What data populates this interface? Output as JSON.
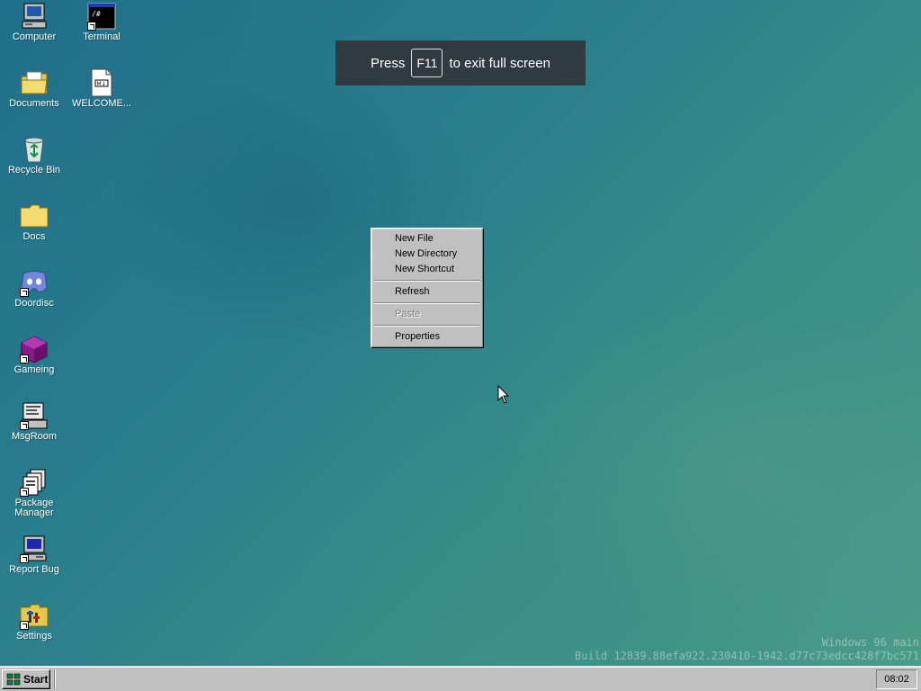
{
  "desktop_icons": [
    {
      "label": "Computer",
      "icon": "computer-icon",
      "shortcut": false
    },
    {
      "label": "Terminal",
      "icon": "terminal-icon",
      "shortcut": true
    },
    {
      "label": "Documents",
      "icon": "documents-folder-icon",
      "shortcut": false
    },
    {
      "label": "WELCOME...",
      "icon": "markdown-file-icon",
      "shortcut": false
    },
    {
      "label": "Recycle Bin",
      "icon": "recycle-bin-icon",
      "shortcut": false
    },
    {
      "label": "Docs",
      "icon": "folder-icon",
      "shortcut": false
    },
    {
      "label": "Doordisc",
      "icon": "doordisc-icon",
      "shortcut": true
    },
    {
      "label": "Gameing",
      "icon": "gameing-cube-icon",
      "shortcut": true
    },
    {
      "label": "MsgRoom",
      "icon": "msgroom-icon",
      "shortcut": true
    },
    {
      "label": "Package Manager",
      "icon": "package-manager-icon",
      "shortcut": true
    },
    {
      "label": "Report Bug",
      "icon": "report-bug-computer-icon",
      "shortcut": true
    },
    {
      "label": "Settings",
      "icon": "settings-folder-icon",
      "shortcut": true
    }
  ],
  "fullscreen_notice": {
    "prefix": "Press",
    "key": "F11",
    "suffix": "to exit full screen"
  },
  "context_menu": {
    "items": [
      {
        "label": "New File",
        "disabled": false
      },
      {
        "label": "New Directory",
        "disabled": false
      },
      {
        "label": "New Shortcut",
        "disabled": false
      },
      {
        "label": "Refresh",
        "disabled": false
      },
      {
        "label": "Paste",
        "disabled": true
      },
      {
        "label": "Properties",
        "disabled": false
      }
    ]
  },
  "watermark": {
    "line1": "Windows 96 main",
    "line2": "Build 12839.88efa922.230410-1942.d77c73edcc428f7bc571"
  },
  "taskbar": {
    "start_label": "Start",
    "clock": "08:02"
  },
  "colors": {
    "desktop_teal": "#2a7f8c",
    "taskbar_gray": "#c0c0c0",
    "notice_bg": "#2f3b40"
  }
}
